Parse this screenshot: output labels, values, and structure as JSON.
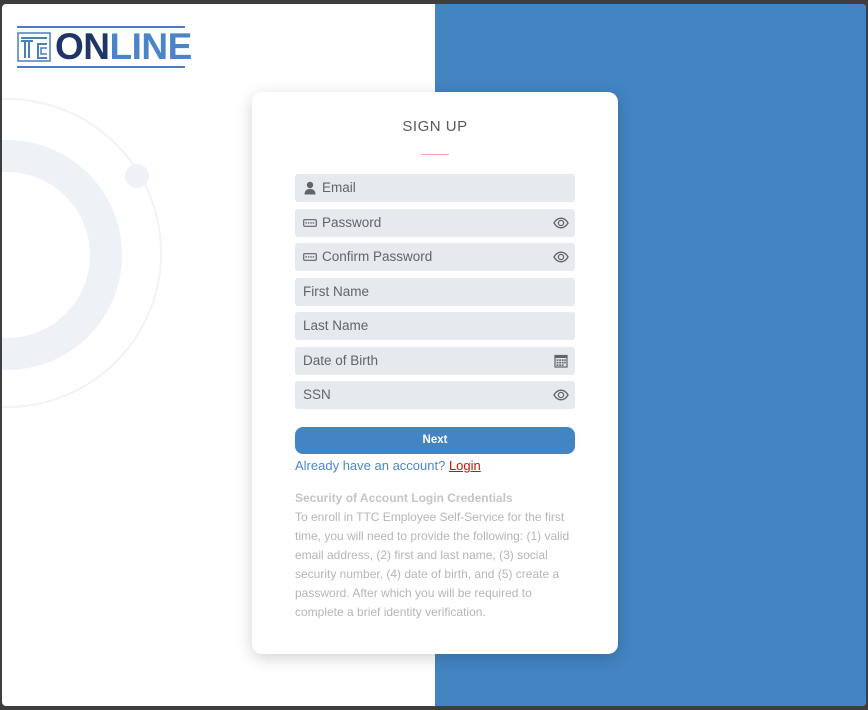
{
  "logo": {
    "text_part1": "ON",
    "text_part2": "LINE",
    "mark": "TTC"
  },
  "signup": {
    "title": "SIGN UP",
    "fields": [
      {
        "placeholder": "Email",
        "icon": "user-icon"
      },
      {
        "placeholder": "Password",
        "icon": "keyboard-icon",
        "trailing_icon": "eye-icon"
      },
      {
        "placeholder": "Confirm Password",
        "icon": "keyboard-icon",
        "trailing_icon": "eye-icon"
      },
      {
        "placeholder": "First Name"
      },
      {
        "placeholder": "Last Name"
      },
      {
        "placeholder": "Date of Birth",
        "trailing_icon": "calendar-icon"
      },
      {
        "placeholder": "SSN",
        "trailing_icon": "eye-icon"
      }
    ],
    "next_label": "Next",
    "account_question": "Already have an account?",
    "login_link": "Login"
  },
  "security": {
    "title": "Security of Account Login Credentials",
    "body": "To enroll in TTC Employee Self-Service for the first time, you will need to provide the following: (1) valid email address, (2) first and last name, (3) social security number, (4) date of birth, and (5) create a password. After which you will be required to complete a brief identity verification."
  },
  "colors": {
    "accent": "#4384c3",
    "logo_dark": "#1e3566",
    "logo_light": "#4a85c9",
    "field_bg": "#e6e9ee",
    "login_link": "#cc1111"
  }
}
